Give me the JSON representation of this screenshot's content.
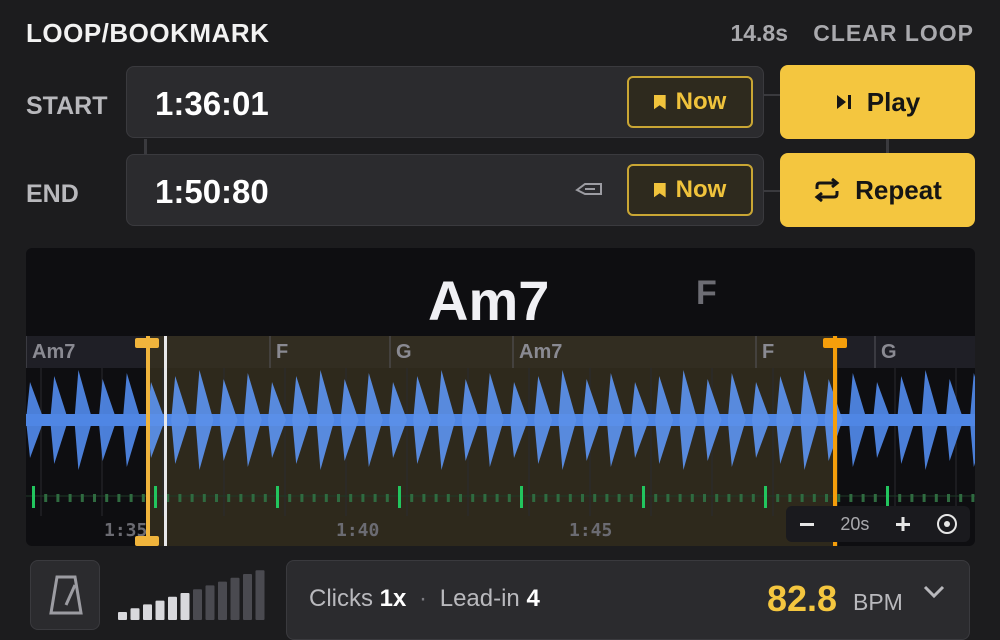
{
  "header": {
    "title": "LOOP/BOOKMARK",
    "duration": "14.8s",
    "clear_label": "CLEAR LOOP"
  },
  "start": {
    "label": "START",
    "time": "1:36:01",
    "now_label": "Now"
  },
  "end": {
    "label": "END",
    "time": "1:50:80",
    "now_label": "Now"
  },
  "actions": {
    "play_label": "Play",
    "repeat_label": "Repeat"
  },
  "chords": {
    "current": "Am7",
    "next": "F",
    "track": [
      "Am7",
      "F",
      "G",
      "Am7",
      "F",
      "G"
    ]
  },
  "timeline": {
    "labels": [
      "1:35",
      "1:40",
      "1:45"
    ],
    "zoom_label": "20s",
    "zoom_out_icon": "minus-icon",
    "zoom_in_icon": "plus-icon",
    "center_icon": "target-icon"
  },
  "metronome": {
    "icon": "metronome-icon",
    "clicks_label": "Clicks",
    "clicks_value": "1x",
    "separator": "·",
    "leadin_label": "Lead-in",
    "leadin_value": "4",
    "bpm": "82.8",
    "bpm_unit": "BPM",
    "volume_level": 0.5
  },
  "colors": {
    "accent": "#f4c63f",
    "waveform": "#4f86e4",
    "loop_marker": "#f0b43c",
    "end_marker": "#f59e0b",
    "beat_green": "#22c55e"
  }
}
